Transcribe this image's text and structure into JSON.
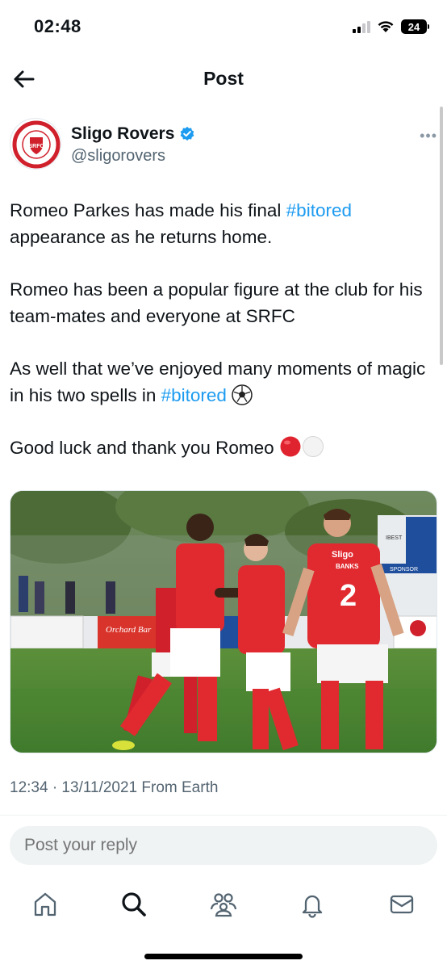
{
  "status_bar": {
    "time": "02:48",
    "battery_level": "24"
  },
  "nav": {
    "title": "Post",
    "back_icon": "arrow-left-icon"
  },
  "author": {
    "name": "Sligo Rovers",
    "handle": "@sligorovers",
    "avatar_logo_text": [
      "SLIGO ROVERS",
      "SRFC",
      "FOOTBALL CLUB"
    ],
    "more_label": "•••"
  },
  "post": {
    "p1_a": "Romeo Parkes has made his final ",
    "p1_tag": "#bitored",
    "p1_b": "appearance as he returns home.",
    "p2": "Romeo has been a popular figure at the club for his team-mates and everyone at SRFC",
    "p3_a": "As well that we’ve enjoyed many moments of magic in his two spells in ",
    "p3_tag": "#bitored",
    "p3_emoji": "soccer-ball",
    "p4_a": "Good luck and thank you Romeo ",
    "p4_emojis": [
      "red-circle",
      "white-circle"
    ]
  },
  "media": {
    "description": "players celebrating",
    "visible_text": [
      "Sligo",
      "BANKS",
      "2",
      "SPONSOR"
    ]
  },
  "meta": {
    "timestamp": "12:34 · 13/11/2021 From Earth"
  },
  "reply": {
    "placeholder": "Post your reply"
  },
  "tabbar": {
    "items": [
      "home-icon",
      "search-icon",
      "communities-icon",
      "notifications-icon",
      "messages-icon"
    ]
  },
  "colors": {
    "accent": "#1d9bf0",
    "brand_red": "#d0202c",
    "text": "#0f1419",
    "muted": "#536471"
  }
}
